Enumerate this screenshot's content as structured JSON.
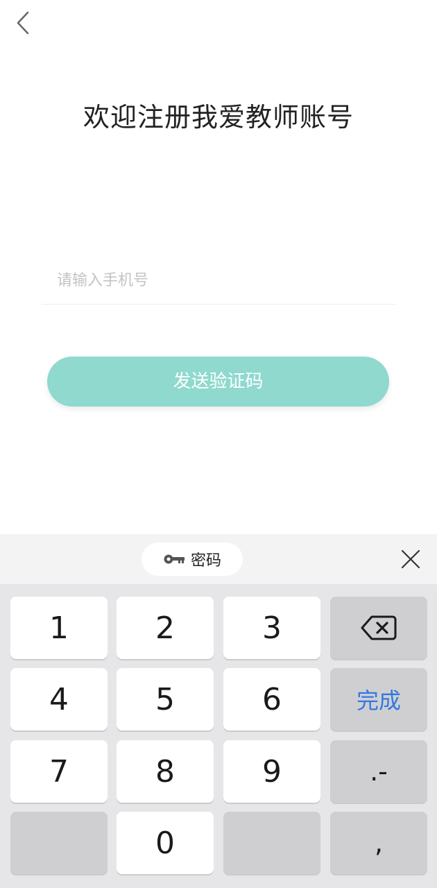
{
  "header": {
    "title": "欢迎注册我爱教师账号"
  },
  "form": {
    "phone_placeholder": "请输入手机号",
    "phone_value": "",
    "send_code_label": "发送验证码"
  },
  "keyboard": {
    "password_chip_label": "密码",
    "keys": {
      "k1": "1",
      "k2": "2",
      "k3": "3",
      "k4": "4",
      "k5": "5",
      "k6": "6",
      "k7": "7",
      "k8": "8",
      "k9": "9",
      "k0": "0",
      "done": "完成",
      "dot_dash": ".-",
      "comma": ","
    }
  },
  "colors": {
    "accent": "#8fd9cf",
    "done_text": "#3478e0",
    "keyboard_bg": "#e6e6e8"
  }
}
